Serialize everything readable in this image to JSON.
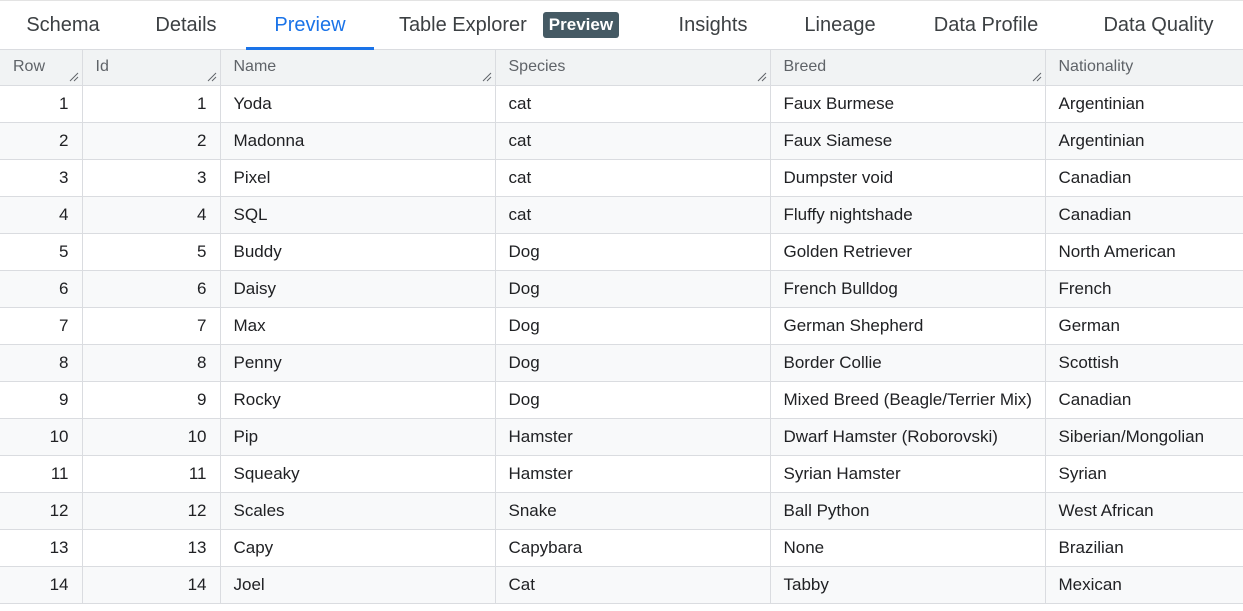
{
  "tabs": [
    {
      "label": "Schema",
      "active": false
    },
    {
      "label": "Details",
      "active": false
    },
    {
      "label": "Preview",
      "active": true
    },
    {
      "label": "Table Explorer",
      "badge": "Preview",
      "active": false
    },
    {
      "label": "Insights",
      "active": false
    },
    {
      "label": "Lineage",
      "active": false
    },
    {
      "label": "Data Profile",
      "active": false
    },
    {
      "label": "Data Quality",
      "active": false
    }
  ],
  "table": {
    "columns": [
      "Row",
      "Id",
      "Name",
      "Species",
      "Breed",
      "Nationality"
    ],
    "rows": [
      [
        "1",
        "1",
        "Yoda",
        "cat",
        "Faux Burmese",
        "Argentinian"
      ],
      [
        "2",
        "2",
        "Madonna",
        "cat",
        "Faux Siamese",
        "Argentinian"
      ],
      [
        "3",
        "3",
        "Pixel",
        "cat",
        "Dumpster void",
        "Canadian"
      ],
      [
        "4",
        "4",
        "SQL",
        "cat",
        "Fluffy nightshade",
        "Canadian"
      ],
      [
        "5",
        "5",
        "Buddy",
        "Dog",
        "Golden Retriever",
        "North American"
      ],
      [
        "6",
        "6",
        "Daisy",
        "Dog",
        "French Bulldog",
        "French"
      ],
      [
        "7",
        "7",
        "Max",
        "Dog",
        "German Shepherd",
        "German"
      ],
      [
        "8",
        "8",
        "Penny",
        "Dog",
        "Border Collie",
        "Scottish"
      ],
      [
        "9",
        "9",
        "Rocky",
        "Dog",
        "Mixed Breed (Beagle/Terrier Mix)",
        "Canadian"
      ],
      [
        "10",
        "10",
        "Pip",
        "Hamster",
        "Dwarf Hamster (Roborovski)",
        "Siberian/Mongolian"
      ],
      [
        "11",
        "11",
        "Squeaky",
        "Hamster",
        "Syrian Hamster",
        "Syrian"
      ],
      [
        "12",
        "12",
        "Scales",
        "Snake",
        "Ball Python",
        "West African"
      ],
      [
        "13",
        "13",
        "Capy",
        "Capybara",
        "None",
        "Brazilian"
      ],
      [
        "14",
        "14",
        "Joel",
        "Cat",
        "Tabby",
        "Mexican"
      ]
    ]
  },
  "colors": {
    "accent": "#1a73e8",
    "badge_bg": "#455a64",
    "header_bg": "#f1f3f4",
    "alt_row_bg": "#f8f9fa"
  },
  "icons": {
    "column_resize": "column-resize-handle-icon"
  }
}
